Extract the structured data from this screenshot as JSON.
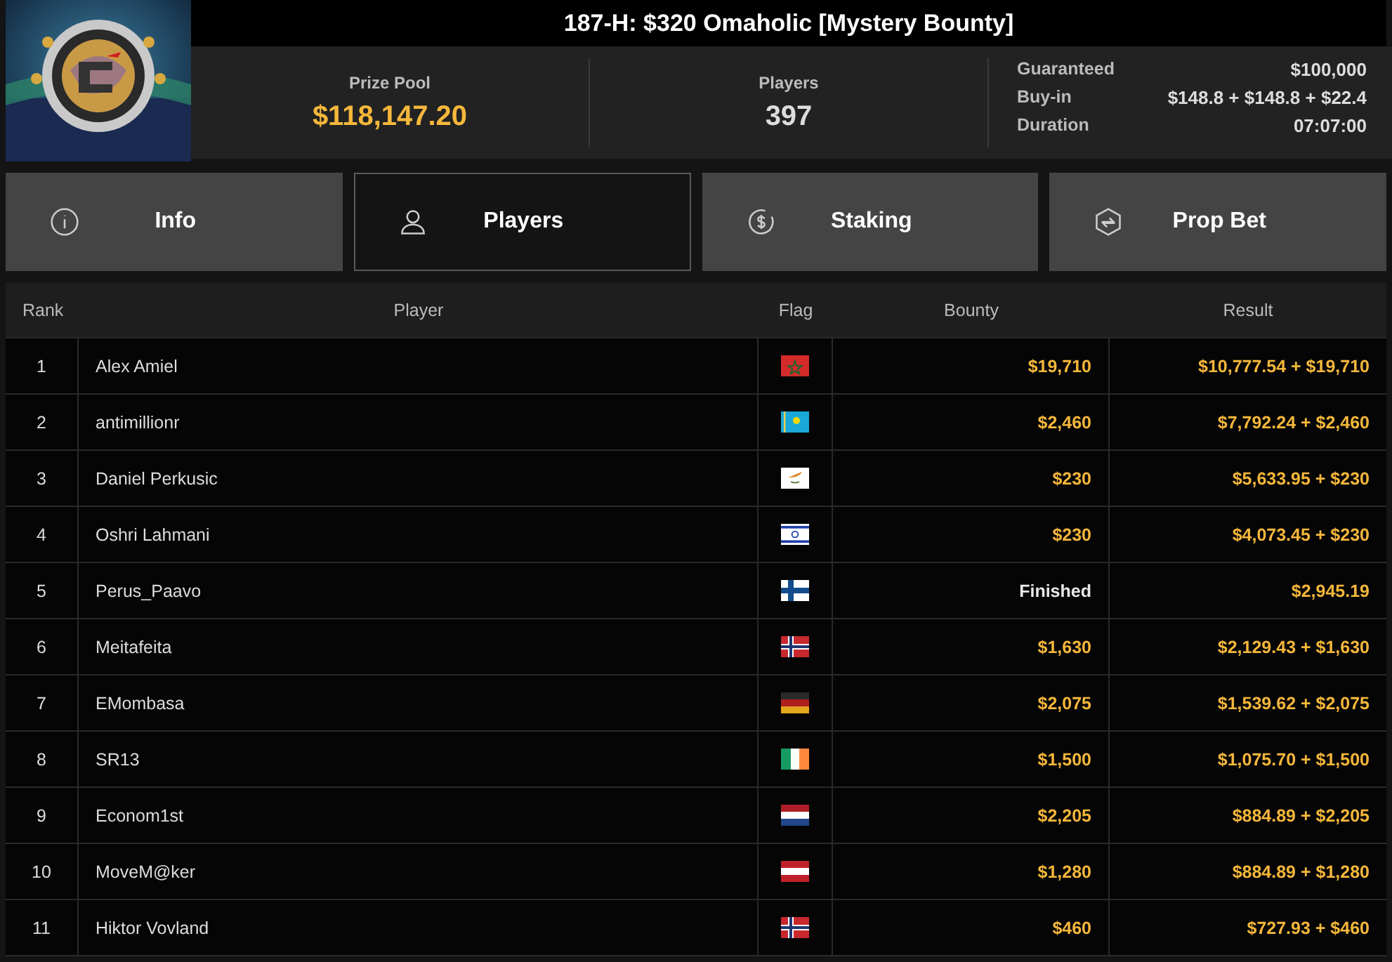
{
  "title": "187-H: $320 Omaholic [Mystery Bounty]",
  "stats": [
    {
      "label": "Prize Pool",
      "value": "$118,147.20",
      "highlight": true
    },
    {
      "label": "Players",
      "value": "397",
      "highlight": false
    }
  ],
  "details": [
    {
      "label": "Guaranteed",
      "value": "$100,000"
    },
    {
      "label": "Buy-in",
      "value": "$148.8 + $148.8 + $22.4"
    },
    {
      "label": "Duration",
      "value": "07:07:00"
    }
  ],
  "tabs": [
    {
      "label": "Info",
      "kind": "info",
      "selected": false
    },
    {
      "label": "Players",
      "kind": "players",
      "selected": true
    },
    {
      "label": "Staking",
      "kind": "staking",
      "selected": false
    },
    {
      "label": "Prop Bet",
      "kind": "propbet",
      "selected": false
    }
  ],
  "table": {
    "columns": [
      "Rank",
      "Player",
      "Flag",
      "Bounty",
      "Result"
    ],
    "rows": [
      {
        "rank": "1",
        "player": "Alex Amiel",
        "kind": "ma",
        "bounty": "$19,710",
        "finished": false,
        "result": "$10,777.54 + $19,710"
      },
      {
        "rank": "2",
        "player": "antimillionr",
        "kind": "kz",
        "bounty": "$2,460",
        "finished": false,
        "result": "$7,792.24 + $2,460"
      },
      {
        "rank": "3",
        "player": "Daniel Perkusic",
        "kind": "cy",
        "bounty": "$230",
        "finished": false,
        "result": "$5,633.95 + $230"
      },
      {
        "rank": "4",
        "player": "Oshri Lahmani",
        "kind": "il",
        "bounty": "$230",
        "finished": false,
        "result": "$4,073.45 + $230"
      },
      {
        "rank": "5",
        "player": "Perus_Paavo",
        "kind": "fi",
        "bounty": "Finished",
        "finished": true,
        "result": "$2,945.19"
      },
      {
        "rank": "6",
        "player": "Meitafeita",
        "kind": "no",
        "bounty": "$1,630",
        "finished": false,
        "result": "$2,129.43 + $1,630"
      },
      {
        "rank": "7",
        "player": "EMombasa",
        "kind": "de",
        "bounty": "$2,075",
        "finished": false,
        "result": "$1,539.62 + $2,075"
      },
      {
        "rank": "8",
        "player": "SR13",
        "kind": "ie",
        "bounty": "$1,500",
        "finished": false,
        "result": "$1,075.70 + $1,500"
      },
      {
        "rank": "9",
        "player": "Econom1st",
        "kind": "nl",
        "bounty": "$2,205",
        "finished": false,
        "result": "$884.89 + $2,205"
      },
      {
        "rank": "10",
        "player": "MoveM@ker",
        "kind": "at",
        "bounty": "$1,280",
        "finished": false,
        "result": "$884.89 + $1,280"
      },
      {
        "rank": "11",
        "player": "Hiktor Vovland",
        "kind": "no",
        "bounty": "$460",
        "finished": false,
        "result": "$727.93 + $460"
      }
    ]
  }
}
